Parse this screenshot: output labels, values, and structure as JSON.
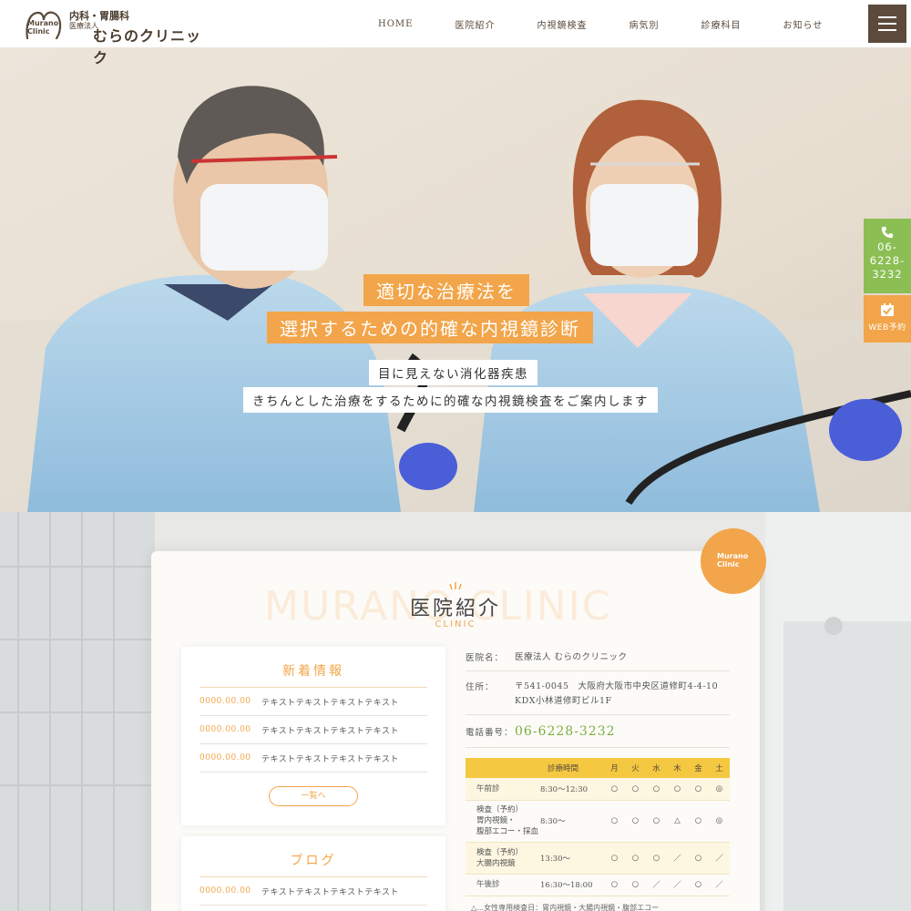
{
  "header": {
    "logo_mark": "Murano Clinic",
    "logo_dept": "内科・胃腸科",
    "logo_corp": "医療法人",
    "logo_name": "むらのクリニック",
    "nav": [
      "HOME",
      "医院紹介",
      "内視鏡検査",
      "病気別",
      "診療科目",
      "お知らせ"
    ]
  },
  "hero": {
    "line1": "適切な治療法を",
    "line2": "選択するための的確な内視鏡診断",
    "sub1": "目に見えない消化器疾患",
    "sub2": "きちんとした治療をするために的確な内視鏡検査をご案内します"
  },
  "side": {
    "tel": "06-6228-3232",
    "web": "WEB予約"
  },
  "section": {
    "watermark": "MURANO CLINIC",
    "title": "医院紹介",
    "subtitle": "CLINIC",
    "badge": "Murano Clinic"
  },
  "news": {
    "title": "新着情報",
    "items": [
      {
        "date": "0000.00.00",
        "text": "テキストテキストテキストテキスト"
      },
      {
        "date": "0000.00.00",
        "text": "テキストテキストテキストテキスト"
      },
      {
        "date": "0000.00.00",
        "text": "テキストテキストテキストテキスト"
      }
    ],
    "more": "一覧へ"
  },
  "blog": {
    "title": "ブログ",
    "items": [
      {
        "date": "0000.00.00",
        "text": "テキストテキストテキストテキスト"
      }
    ]
  },
  "info": {
    "name_label": "医院名：",
    "name": "医療法人 むらのクリニック",
    "address_label": "住所：",
    "address1": "〒541-0045　大阪府大阪市中央区道修町4-4-10",
    "address2": "KDX小林道修町ビル1F",
    "tel_label": "電話番号：",
    "tel": "06-6228-3232"
  },
  "schedule": {
    "headers": [
      "",
      "診療時間",
      "月",
      "火",
      "水",
      "木",
      "金",
      "土"
    ],
    "rows": [
      {
        "label": [
          "午前診"
        ],
        "time": "8:30～12:30",
        "marks": [
          "○",
          "○",
          "○",
          "○",
          "○",
          "◎"
        ]
      },
      {
        "label": [
          "検査（予約）",
          "胃内視鏡・",
          "腹部エコー・採血"
        ],
        "time": "8:30～",
        "marks": [
          "○",
          "○",
          "○",
          "△",
          "○",
          "◎"
        ]
      },
      {
        "label": [
          "検査（予約）",
          "大腸内視鏡"
        ],
        "time": "13:30～",
        "marks": [
          "○",
          "○",
          "○",
          "／",
          "○",
          "／"
        ]
      },
      {
        "label": [
          "午後診"
        ],
        "time": "16:30～18:00",
        "marks": [
          "○",
          "○",
          "／",
          "／",
          "○",
          "／"
        ]
      }
    ],
    "note": "△…女性専用検査日：胃内視鏡・大腸内視鏡・腹部エコー"
  },
  "colors": {
    "accent": "#f2a54a",
    "green": "#8bbf54",
    "brown": "#5c4a3c",
    "schedule_header": "#f5c842"
  }
}
